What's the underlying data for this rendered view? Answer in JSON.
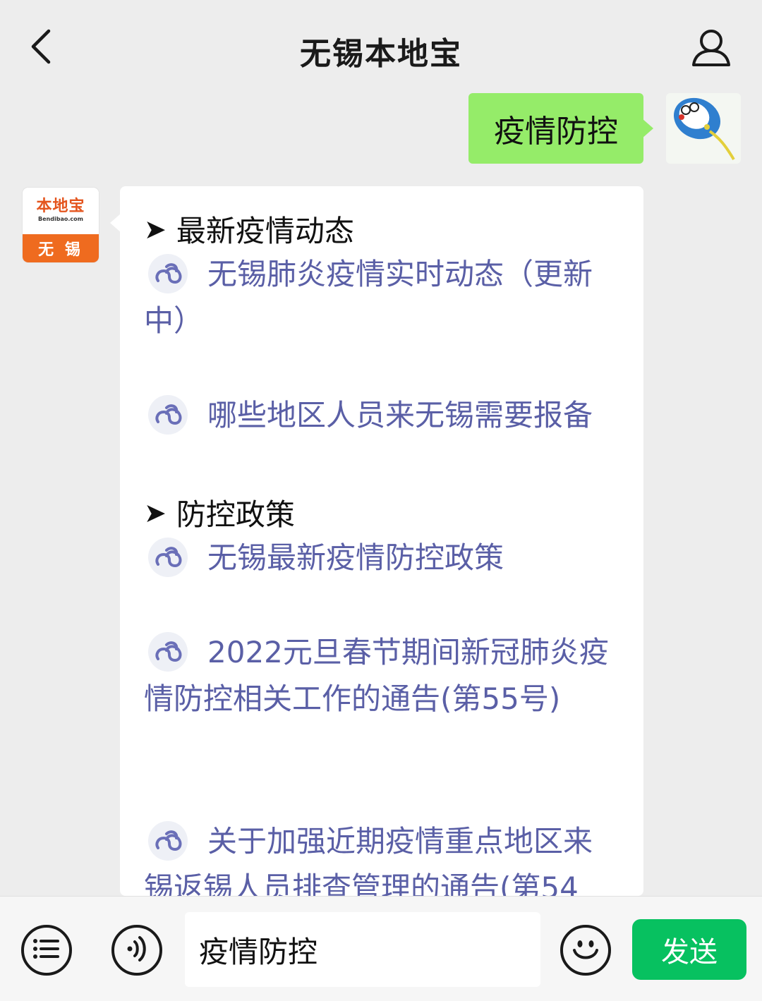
{
  "header": {
    "title": "无锡本地宝",
    "back_icon": "chevron-left-icon",
    "profile_icon": "person-icon"
  },
  "outgoing": {
    "text": "疫情防控"
  },
  "bot_avatar": {
    "brand": "本地宝",
    "url": "Bendibao.com",
    "city": "无 锡"
  },
  "message": {
    "sections": [
      {
        "title": "最新疫情动态",
        "links": [
          "无锡肺炎疫情实时动态（更新中）",
          "哪些地区人员来无锡需要报备"
        ]
      },
      {
        "title": "防控政策",
        "links": [
          "无锡最新疫情防控政策",
          "2022元旦春节期间新冠肺炎疫情防控相关工作的通告(第55号)",
          "关于加强近期疫情重点地区来锡返锡人员排查管理的通告(第54"
        ]
      }
    ],
    "arrow": "➤"
  },
  "input_bar": {
    "menu_icon": "menu-list-icon",
    "voice_icon": "voice-icon",
    "input_value": "疫情防控",
    "emoji_icon": "smiley-icon",
    "send_label": "发送"
  },
  "colors": {
    "background": "#ededed",
    "outgoing_bubble": "#95ec69",
    "link_text": "#5a5fa6",
    "send_button": "#07c160"
  }
}
